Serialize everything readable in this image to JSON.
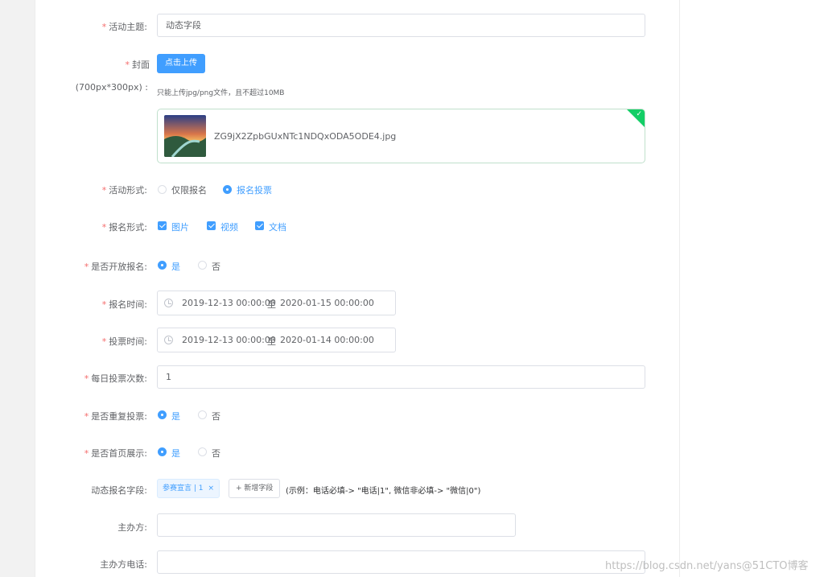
{
  "form": {
    "topic": {
      "label": "活动主题:",
      "value": "动态字段"
    },
    "cover": {
      "label": "封面",
      "size_note": "(700px*300px) :",
      "upload_button": "点击上传",
      "hint": "只能上传jpg/png文件，且不超过10MB",
      "file_name": "ZG9jX2ZpbGUxNTc1NDQxODA5ODE4.jpg"
    },
    "activity_type": {
      "label": "活动形式:",
      "options": [
        "仅限报名",
        "报名投票"
      ],
      "selected": 1
    },
    "signup_type": {
      "label": "报名形式:",
      "options": [
        "图片",
        "视频",
        "文档"
      ]
    },
    "open_signup": {
      "label": "是否开放报名:",
      "options": [
        "是",
        "否"
      ],
      "selected": 0
    },
    "signup_time": {
      "label": "报名时间:",
      "start": "2019-12-13 00:00:00",
      "sep": "至",
      "end": "2020-01-15 00:00:00"
    },
    "vote_time": {
      "label": "投票时间:",
      "start": "2019-12-13 00:00:00",
      "sep": "至",
      "end": "2020-01-14 00:00:00"
    },
    "daily_votes": {
      "label": "每日投票次数:",
      "value": "1"
    },
    "repeat_vote": {
      "label": "是否重复投票:",
      "options": [
        "是",
        "否"
      ],
      "selected": 0
    },
    "homepage_show": {
      "label": "是否首页展示:",
      "options": [
        "是",
        "否"
      ],
      "selected": 0
    },
    "dynamic_fields": {
      "label": "动态报名字段:",
      "tag": "参赛宣言 | 1",
      "tag_close": "×",
      "add_button": "+ 新增字段",
      "example": "(示例：电话必填-> \"电话|1\", 微信非必填-> \"微信|0\")"
    },
    "organizer": {
      "label": "主办方:",
      "value": ""
    },
    "organizer_phone": {
      "label": "主办方电话:",
      "value": ""
    }
  },
  "watermark": "https://blog.csdn.net/yans@51CTO博客",
  "colors": {
    "primary": "#409eff",
    "required": "#f56c6c",
    "success": "#13ce66"
  }
}
